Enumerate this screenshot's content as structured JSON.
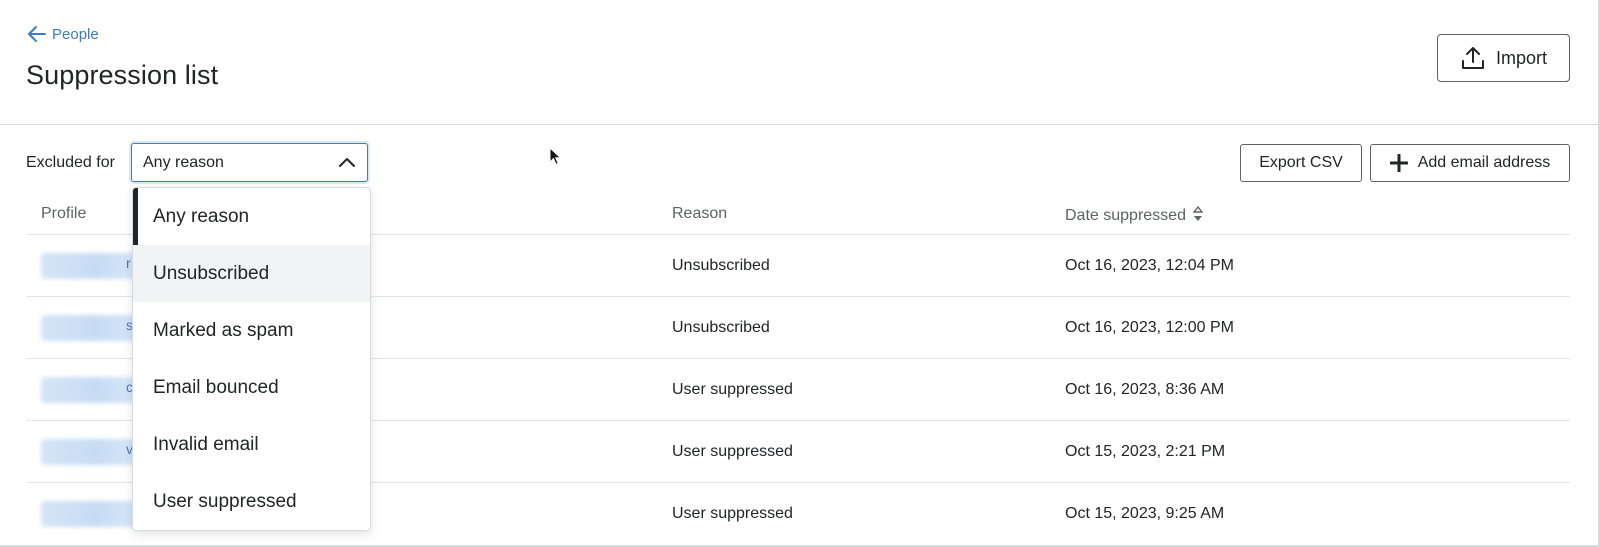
{
  "header": {
    "back_label": "People",
    "title": "Suppression list",
    "import_label": "Import"
  },
  "filter": {
    "label": "Excluded for",
    "selected_value": "Any reason",
    "options": [
      "Any reason",
      "Unsubscribed",
      "Marked as spam",
      "Email bounced",
      "Invalid email",
      "User suppressed"
    ],
    "highlighted_option": "Unsubscribed"
  },
  "actions": {
    "export_label": "Export CSV",
    "add_label": "Add email address"
  },
  "table": {
    "columns": [
      "Profile",
      "Reason",
      "Date suppressed"
    ],
    "rows": [
      {
        "profile_tail": "r",
        "reason": "Unsubscribed",
        "date": "Oct 16, 2023, 12:04 PM"
      },
      {
        "profile_tail": "s",
        "reason": "Unsubscribed",
        "date": "Oct 16, 2023, 12:00 PM"
      },
      {
        "profile_tail": "c",
        "reason": "User suppressed",
        "date": "Oct 16, 2023, 8:36 AM"
      },
      {
        "profile_tail": "v",
        "reason": "User suppressed",
        "date": "Oct 15, 2023, 2:21 PM"
      },
      {
        "profile_tail": "",
        "reason": "User suppressed",
        "date": "Oct 15, 2023, 9:25 AM"
      }
    ]
  },
  "icons": {
    "back": "arrow-left-icon",
    "import": "upload-icon",
    "select_toggle": "chevron-up-icon",
    "add": "plus-icon",
    "sort": "sort-icon"
  },
  "colors": {
    "link": "#3f7bc2",
    "text": "#232426",
    "muted": "#5e6166",
    "border": "#d7d9dc"
  }
}
